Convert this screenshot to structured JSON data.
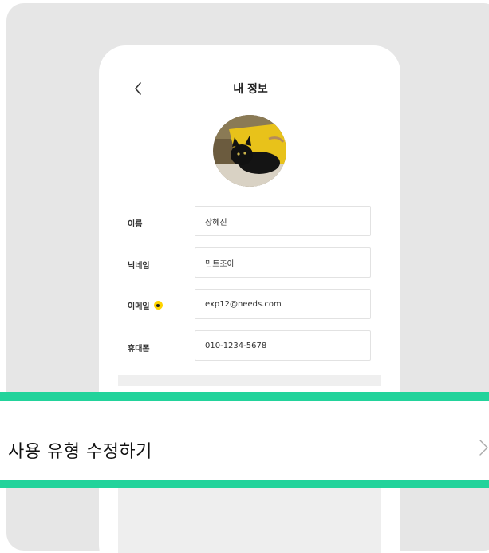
{
  "header": {
    "title": "내 정보"
  },
  "profile": {
    "avatar_alt": "cat-photo"
  },
  "form": {
    "fields": [
      {
        "label": "이름",
        "value": "장혜진",
        "required": false
      },
      {
        "label": "닉네임",
        "value": "민트조아",
        "required": false
      },
      {
        "label": "이메일",
        "value": "exp12@needs.com",
        "required": true
      },
      {
        "label": "휴대폰",
        "value": "010-1234-5678",
        "required": false
      }
    ]
  },
  "menu": {
    "edit_usage_type_label": "사용 유형 수정하기"
  },
  "colors": {
    "highlight": "#22d39b",
    "required_dot": "#ffd400",
    "frame_background": "#e6e6e6"
  },
  "icons": {
    "back": "chevron-left-icon",
    "menu_arrow": "chevron-right-icon",
    "required": "required-dot-icon"
  }
}
